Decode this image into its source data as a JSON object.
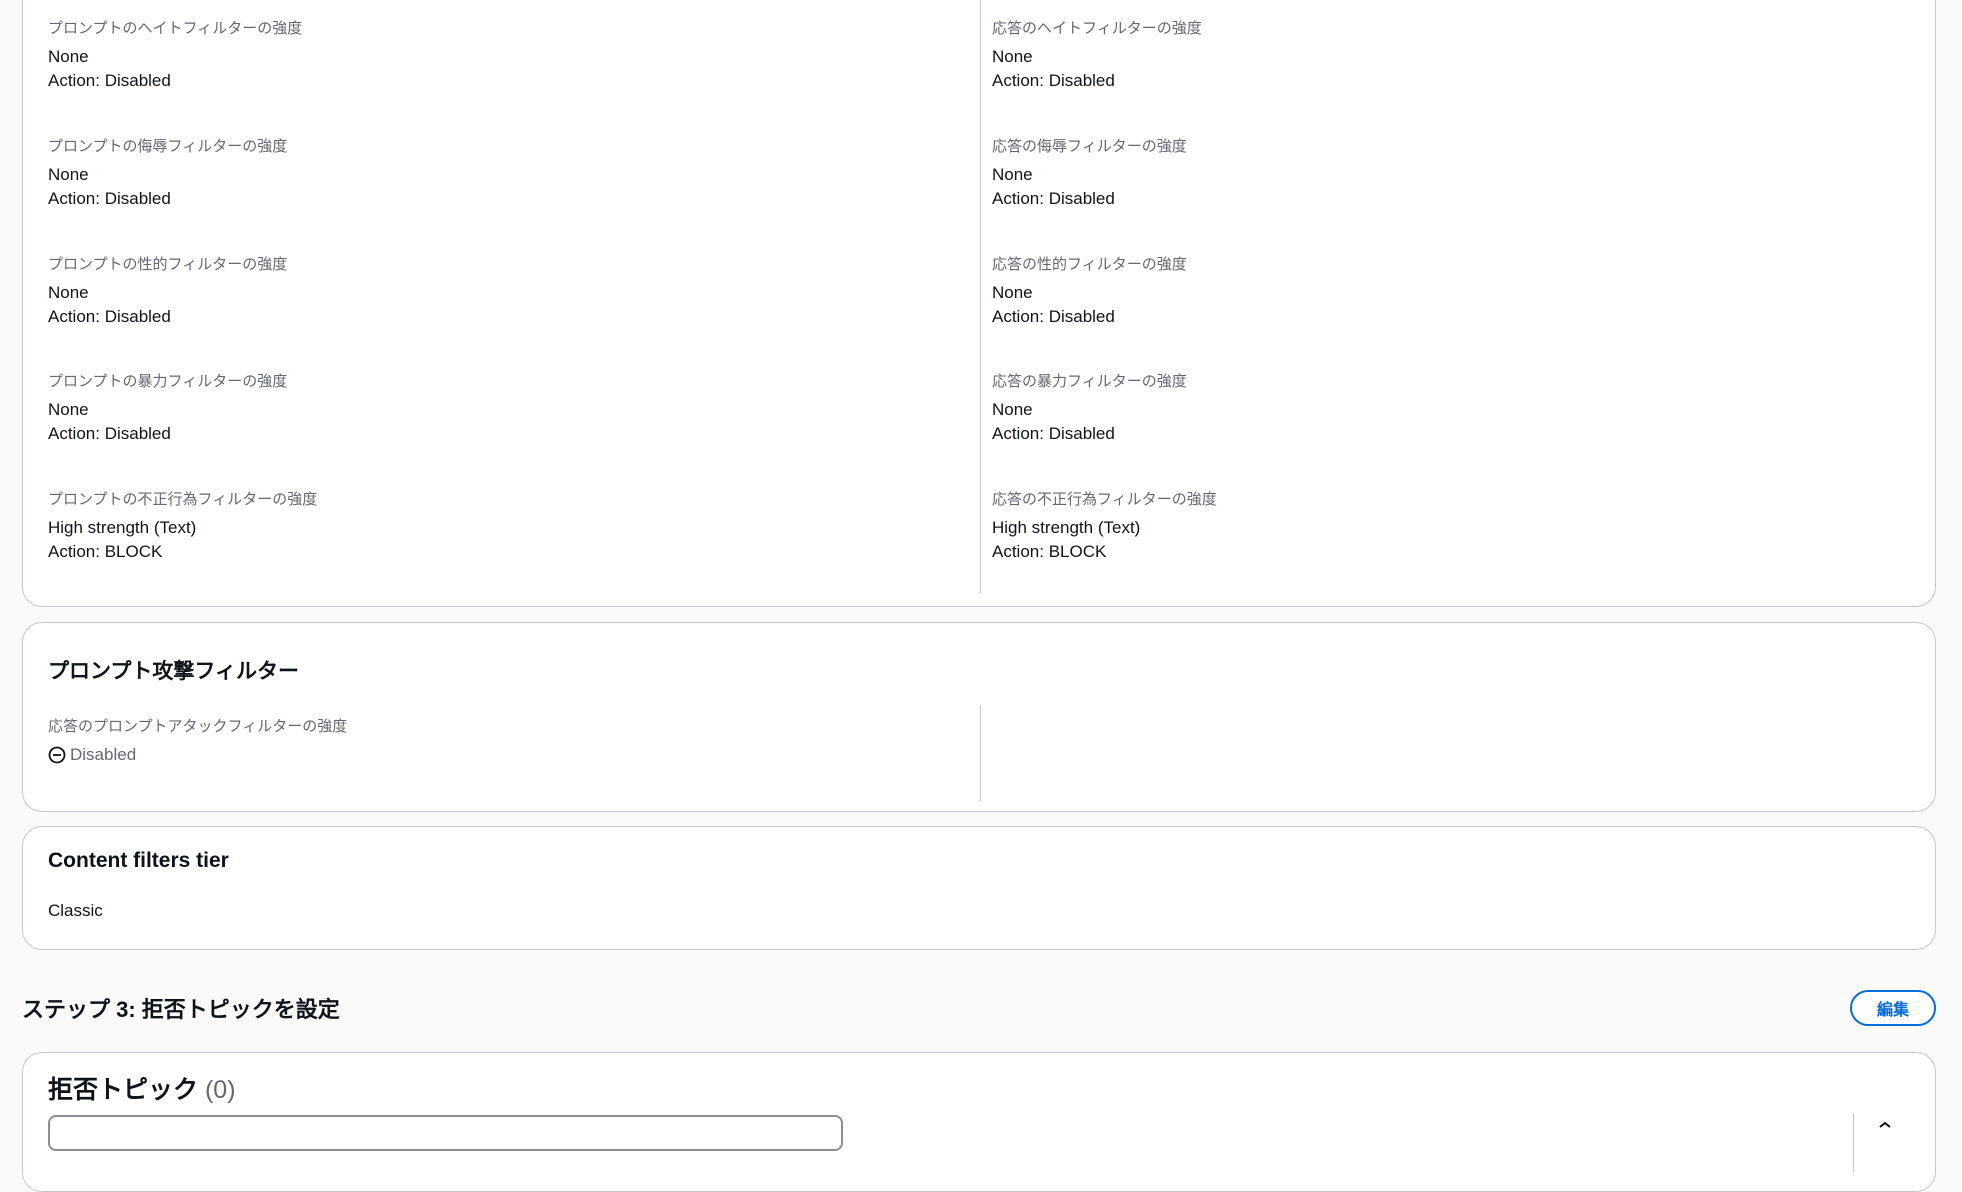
{
  "filters": {
    "left": [
      {
        "label": "プロンプトのヘイトフィルターの強度",
        "strength": "None",
        "action": "Action: Disabled"
      },
      {
        "label": "プロンプトの侮辱フィルターの強度",
        "strength": "None",
        "action": "Action: Disabled"
      },
      {
        "label": "プロンプトの性的フィルターの強度",
        "strength": "None",
        "action": "Action: Disabled"
      },
      {
        "label": "プロンプトの暴力フィルターの強度",
        "strength": "None",
        "action": "Action: Disabled"
      },
      {
        "label": "プロンプトの不正行為フィルターの強度",
        "strength": "High strength (Text)",
        "action": "Action: BLOCK"
      }
    ],
    "right": [
      {
        "label": "応答のヘイトフィルターの強度",
        "strength": "None",
        "action": "Action: Disabled"
      },
      {
        "label": "応答の侮辱フィルターの強度",
        "strength": "None",
        "action": "Action: Disabled"
      },
      {
        "label": "応答の性的フィルターの強度",
        "strength": "None",
        "action": "Action: Disabled"
      },
      {
        "label": "応答の暴力フィルターの強度",
        "strength": "None",
        "action": "Action: Disabled"
      },
      {
        "label": "応答の不正行為フィルターの強度",
        "strength": "High strength (Text)",
        "action": "Action: BLOCK"
      }
    ]
  },
  "prompt_attack": {
    "title": "プロンプト攻撃フィルター",
    "label": "応答のプロンプトアタックフィルターの強度",
    "status": "Disabled",
    "status_icon": "minus-circle-icon"
  },
  "tier": {
    "title": "Content filters tier",
    "value": "Classic"
  },
  "step3": {
    "title": "ステップ 3: 拒否トピックを設定",
    "edit_label": "編集"
  },
  "denied_topics": {
    "title": "拒否トピック",
    "count": "(0)"
  },
  "colors": {
    "accent": "#006ce0",
    "border": "#c6c6cd",
    "muted_text": "#656871",
    "text": "#0f141a"
  }
}
